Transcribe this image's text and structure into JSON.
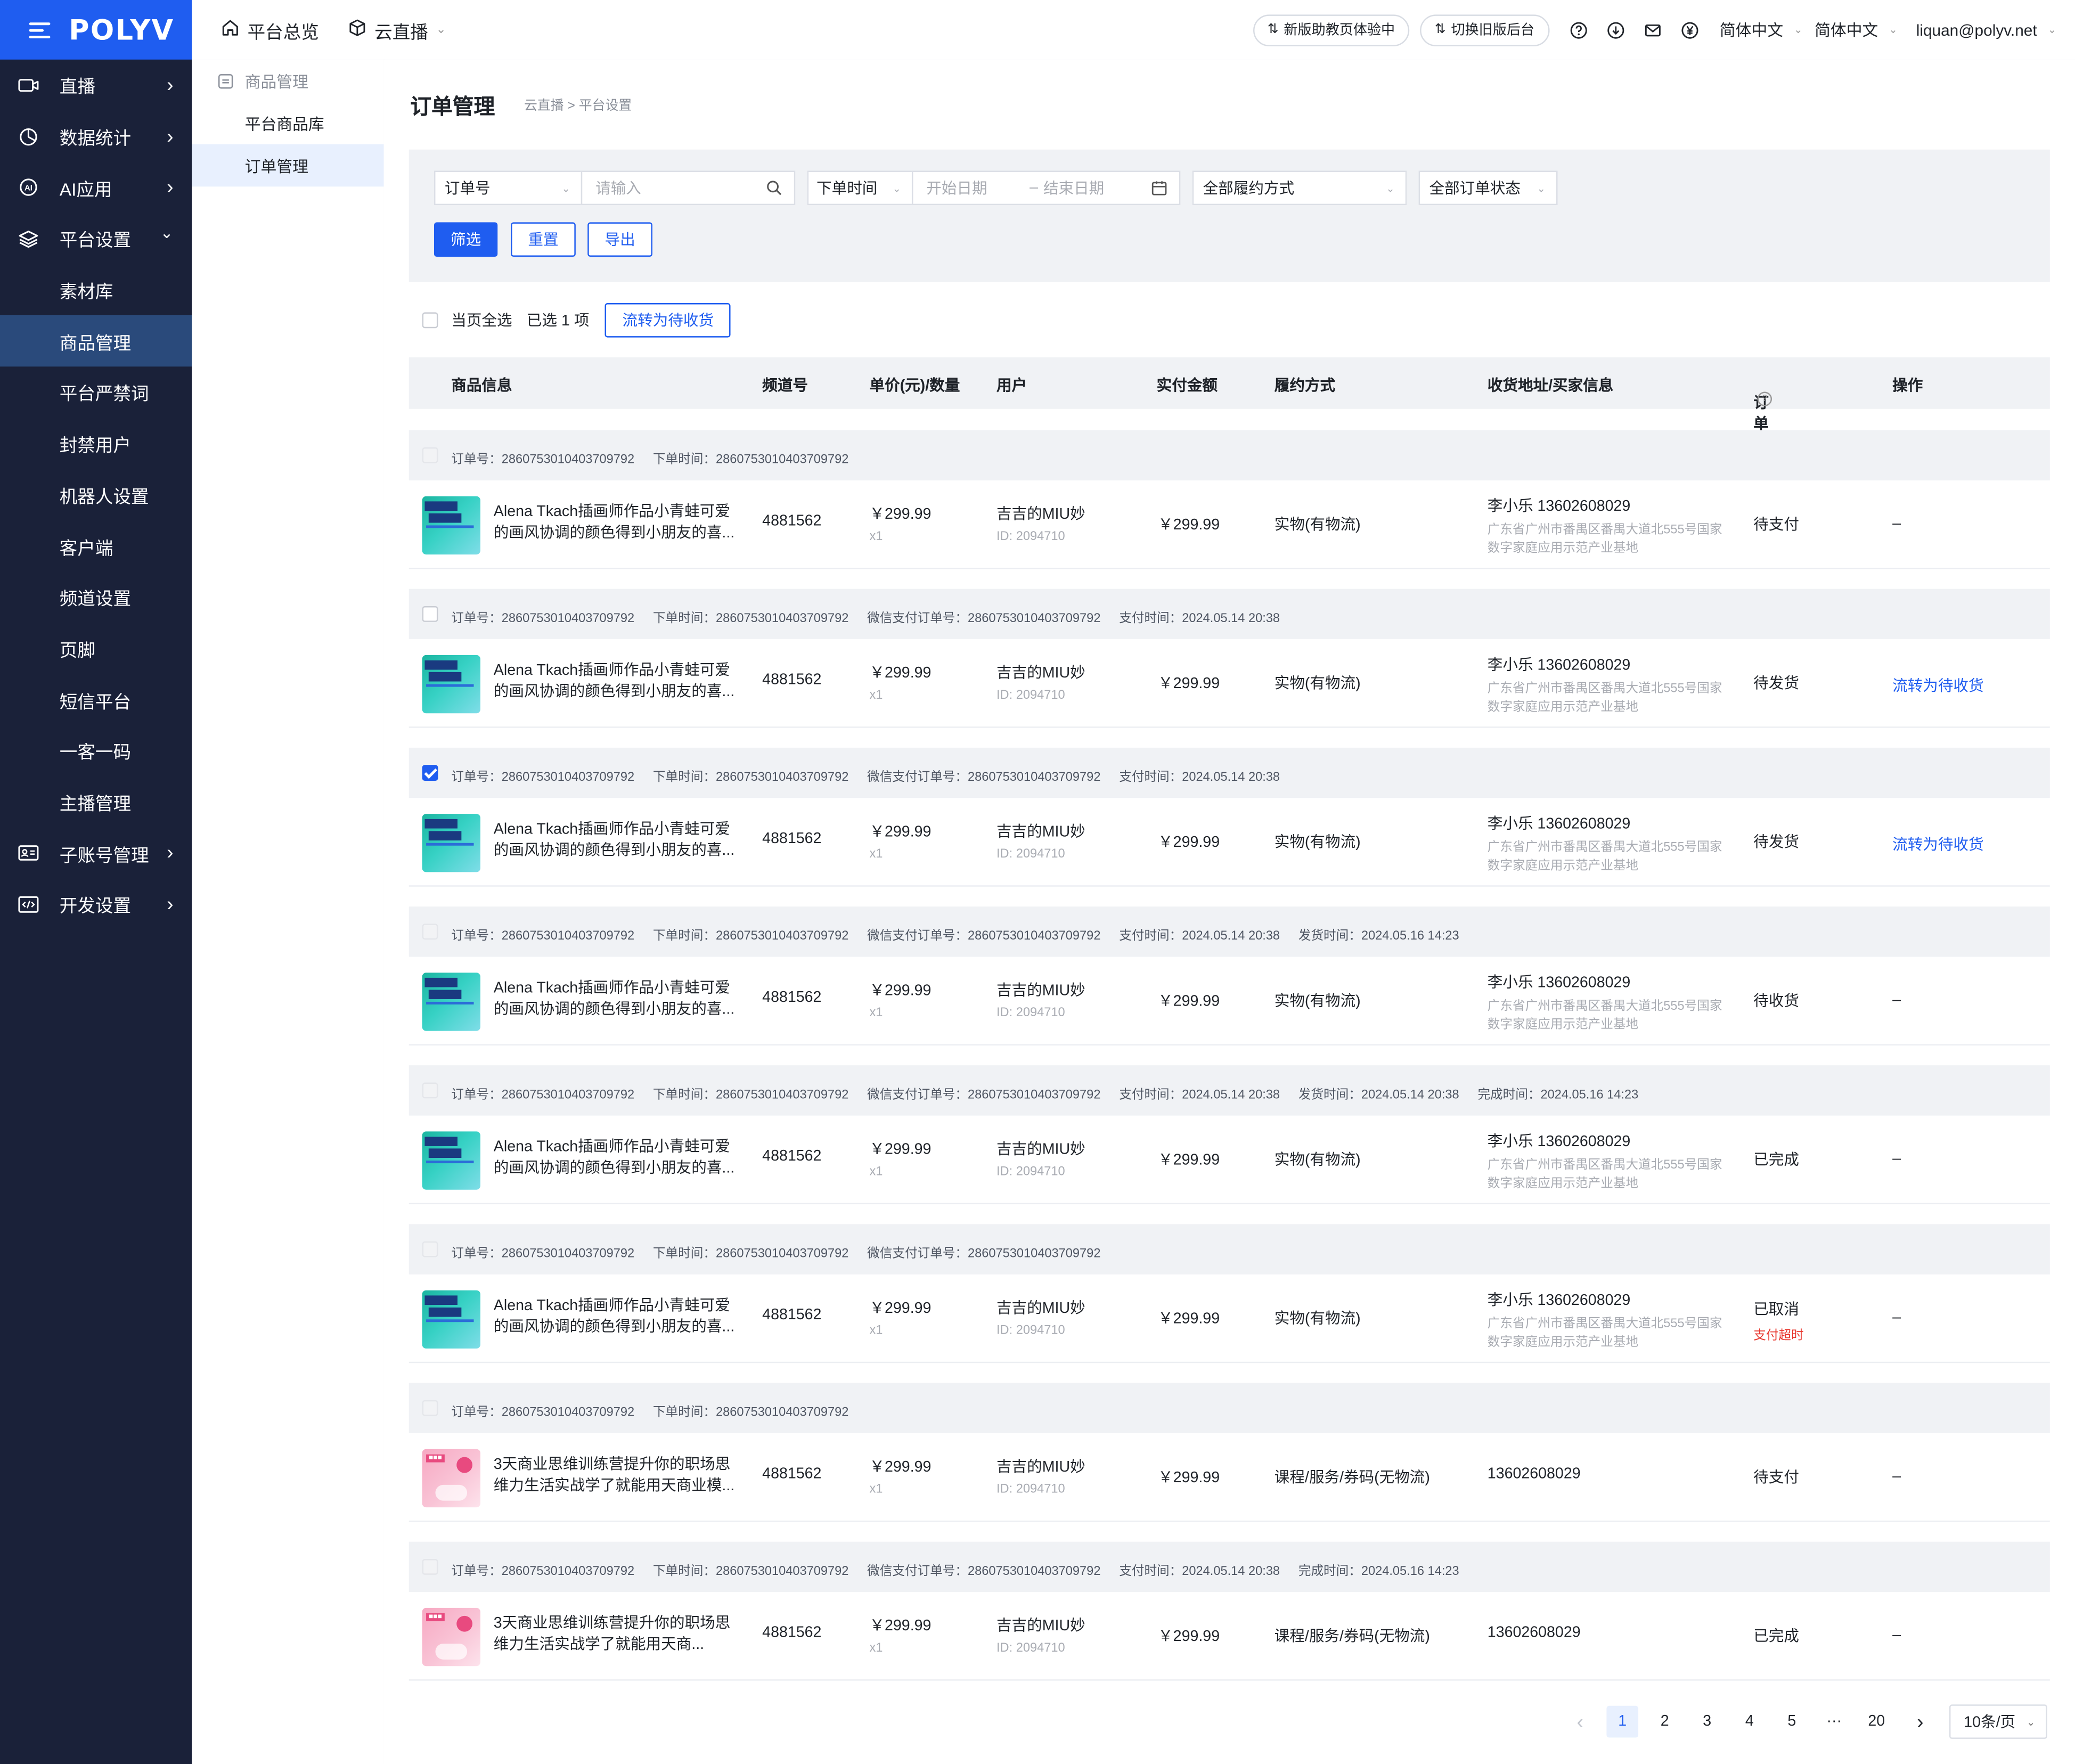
{
  "app": {
    "logo": "POLYV"
  },
  "sidebar": {
    "items": [
      {
        "label": "直播",
        "icon": "video-icon",
        "has_arrow": true
      },
      {
        "label": "数据统计",
        "icon": "pie-chart-icon",
        "has_arrow": true
      },
      {
        "label": "AI应用",
        "icon": "ai-icon",
        "has_arrow": true
      },
      {
        "label": "平台设置",
        "icon": "layers-icon",
        "has_arrow": true,
        "expanded": true
      }
    ],
    "sub_items": [
      "素材库",
      "商品管理",
      "平台严禁词",
      "封禁用户",
      "机器人设置",
      "客户端",
      "频道设置",
      "页脚",
      "短信平台",
      "一客一码",
      "主播管理"
    ],
    "active_sub": "商品管理",
    "bottom_items": [
      {
        "label": "子账号管理",
        "icon": "id-card-icon"
      },
      {
        "label": "开发设置",
        "icon": "code-icon"
      }
    ]
  },
  "topbar": {
    "home": "平台总览",
    "live": "云直播",
    "new_version_btn": "新版助教页体验中",
    "old_version_btn": "切换旧版后台",
    "lang1": "简体中文",
    "lang2": "简体中文",
    "user": "liquan@polyv.net"
  },
  "submenu": {
    "group": "商品管理",
    "items": [
      "平台商品库",
      "订单管理"
    ],
    "active": "订单管理"
  },
  "page": {
    "title": "订单管理",
    "breadcrumb": "云直播 > 平台设置"
  },
  "filters": {
    "field_select": "订单号",
    "search_placeholder": "请输入",
    "time_select": "下单时间",
    "start_placeholder": "开始日期",
    "date_sep": "–",
    "end_placeholder": "结束日期",
    "fulfill_select": "全部履约方式",
    "status_select": "全部订单状态",
    "btn_filter": "筛选",
    "btn_reset": "重置",
    "btn_export": "导出"
  },
  "bulk": {
    "select_all": "当页全选",
    "selected": "已选 1 项",
    "action": "流转为待收货"
  },
  "table_headers": [
    "商品信息",
    "频道号",
    "单价(元)/数量",
    "用户",
    "实付金额",
    "履约方式",
    "收货地址/买家信息",
    "订单状态",
    "操作"
  ],
  "orders": [
    {
      "meta": [
        "订单号：2860753010403709792",
        "下单时间：2860753010403709792"
      ],
      "checkbox": "disabled",
      "thumb": "teal",
      "name1": "Alena Tkach插画师作品小青蛙可爱",
      "name2": "的画风协调的颜色得到小朋友的喜...",
      "channel": "4881562",
      "price": "￥299.99",
      "qty": "x1",
      "user": "吉吉的MIU妙",
      "user_id": "ID: 2094710",
      "paid": "￥299.99",
      "fulfill": "实物(有物流)",
      "addr_name": "李小乐 13602608029",
      "addr1": "广东省广州市番禺区番禺大道北555号国家",
      "addr2": "数字家庭应用示范产业基地",
      "status": "待支付",
      "status_sub": "",
      "op": "–",
      "op_link": false
    },
    {
      "meta": [
        "订单号：2860753010403709792",
        "下单时间：2860753010403709792",
        "微信支付订单号：2860753010403709792",
        "支付时间：2024.05.14 20:38"
      ],
      "checkbox": "empty",
      "thumb": "teal",
      "name1": "Alena Tkach插画师作品小青蛙可爱",
      "name2": "的画风协调的颜色得到小朋友的喜...",
      "channel": "4881562",
      "price": "￥299.99",
      "qty": "x1",
      "user": "吉吉的MIU妙",
      "user_id": "ID: 2094710",
      "paid": "￥299.99",
      "fulfill": "实物(有物流)",
      "addr_name": "李小乐 13602608029",
      "addr1": "广东省广州市番禺区番禺大道北555号国家",
      "addr2": "数字家庭应用示范产业基地",
      "status": "待发货",
      "status_sub": "",
      "op": "流转为待收货",
      "op_link": true
    },
    {
      "meta": [
        "订单号：2860753010403709792",
        "下单时间：2860753010403709792",
        "微信支付订单号：2860753010403709792",
        "支付时间：2024.05.14 20:38"
      ],
      "checkbox": "checked",
      "thumb": "teal",
      "name1": "Alena Tkach插画师作品小青蛙可爱",
      "name2": "的画风协调的颜色得到小朋友的喜...",
      "channel": "4881562",
      "price": "￥299.99",
      "qty": "x1",
      "user": "吉吉的MIU妙",
      "user_id": "ID: 2094710",
      "paid": "￥299.99",
      "fulfill": "实物(有物流)",
      "addr_name": "李小乐 13602608029",
      "addr1": "广东省广州市番禺区番禺大道北555号国家",
      "addr2": "数字家庭应用示范产业基地",
      "status": "待发货",
      "status_sub": "",
      "op": "流转为待收货",
      "op_link": true
    },
    {
      "meta": [
        "订单号：2860753010403709792",
        "下单时间：2860753010403709792",
        "微信支付订单号：2860753010403709792",
        "支付时间：2024.05.14 20:38",
        "发货时间：2024.05.16 14:23"
      ],
      "checkbox": "disabled",
      "thumb": "teal",
      "name1": "Alena Tkach插画师作品小青蛙可爱",
      "name2": "的画风协调的颜色得到小朋友的喜...",
      "channel": "4881562",
      "price": "￥299.99",
      "qty": "x1",
      "user": "吉吉的MIU妙",
      "user_id": "ID: 2094710",
      "paid": "￥299.99",
      "fulfill": "实物(有物流)",
      "addr_name": "李小乐 13602608029",
      "addr1": "广东省广州市番禺区番禺大道北555号国家",
      "addr2": "数字家庭应用示范产业基地",
      "status": "待收货",
      "status_sub": "",
      "op": "–",
      "op_link": false
    },
    {
      "meta": [
        "订单号：2860753010403709792",
        "下单时间：2860753010403709792",
        "微信支付订单号：2860753010403709792",
        "支付时间：2024.05.14 20:38",
        "发货时间：2024.05.14 20:38",
        "完成时间：2024.05.16 14:23"
      ],
      "checkbox": "disabled",
      "thumb": "teal",
      "name1": "Alena Tkach插画师作品小青蛙可爱",
      "name2": "的画风协调的颜色得到小朋友的喜...",
      "channel": "4881562",
      "price": "￥299.99",
      "qty": "x1",
      "user": "吉吉的MIU妙",
      "user_id": "ID: 2094710",
      "paid": "￥299.99",
      "fulfill": "实物(有物流)",
      "addr_name": "李小乐 13602608029",
      "addr1": "广东省广州市番禺区番禺大道北555号国家",
      "addr2": "数字家庭应用示范产业基地",
      "status": "已完成",
      "status_sub": "",
      "op": "–",
      "op_link": false
    },
    {
      "meta": [
        "订单号：2860753010403709792",
        "下单时间：2860753010403709792",
        "微信支付订单号：2860753010403709792"
      ],
      "checkbox": "disabled",
      "thumb": "teal",
      "name1": "Alena Tkach插画师作品小青蛙可爱",
      "name2": "的画风协调的颜色得到小朋友的喜...",
      "channel": "4881562",
      "price": "￥299.99",
      "qty": "x1",
      "user": "吉吉的MIU妙",
      "user_id": "ID: 2094710",
      "paid": "￥299.99",
      "fulfill": "实物(有物流)",
      "addr_name": "李小乐 13602608029",
      "addr1": "广东省广州市番禺区番禺大道北555号国家",
      "addr2": "数字家庭应用示范产业基地",
      "status": "已取消",
      "status_sub": "支付超时",
      "op": "–",
      "op_link": false
    },
    {
      "meta": [
        "订单号：2860753010403709792",
        "下单时间：2860753010403709792"
      ],
      "checkbox": "disabled",
      "thumb": "pink",
      "name1": "3天商业思维训练营提升你的职场思",
      "name2": "维力生活实战学了就能用天商业模...",
      "channel": "4881562",
      "price": "￥299.99",
      "qty": "x1",
      "user": "吉吉的MIU妙",
      "user_id": "ID: 2094710",
      "paid": "￥299.99",
      "fulfill": "课程/服务/券码(无物流)",
      "addr_name": "13602608029",
      "addr1": "",
      "addr2": "",
      "status": "待支付",
      "status_sub": "",
      "op": "–",
      "op_link": false
    },
    {
      "meta": [
        "订单号：2860753010403709792",
        "下单时间：2860753010403709792",
        "微信支付订单号：2860753010403709792",
        "支付时间：2024.05.14 20:38",
        "完成时间：2024.05.16 14:23"
      ],
      "checkbox": "disabled",
      "thumb": "pink",
      "name1": "3天商业思维训练营提升你的职场思",
      "name2": "维力生活实战学了就能用天商...",
      "channel": "4881562",
      "price": "￥299.99",
      "qty": "x1",
      "user": "吉吉的MIU妙",
      "user_id": "ID: 2094710",
      "paid": "￥299.99",
      "fulfill": "课程/服务/券码(无物流)",
      "addr_name": "13602608029",
      "addr1": "",
      "addr2": "",
      "status": "已完成",
      "status_sub": "",
      "op": "–",
      "op_link": false
    }
  ],
  "pagination": {
    "prev": "‹",
    "pages": [
      "1",
      "2",
      "3",
      "4",
      "5",
      "···",
      "20"
    ],
    "next": "›",
    "current": "1",
    "page_size": "10条/页"
  },
  "colors": {
    "primary": "#1f5df0",
    "sidebar_bg": "#1a2139",
    "danger": "#e8372e"
  }
}
